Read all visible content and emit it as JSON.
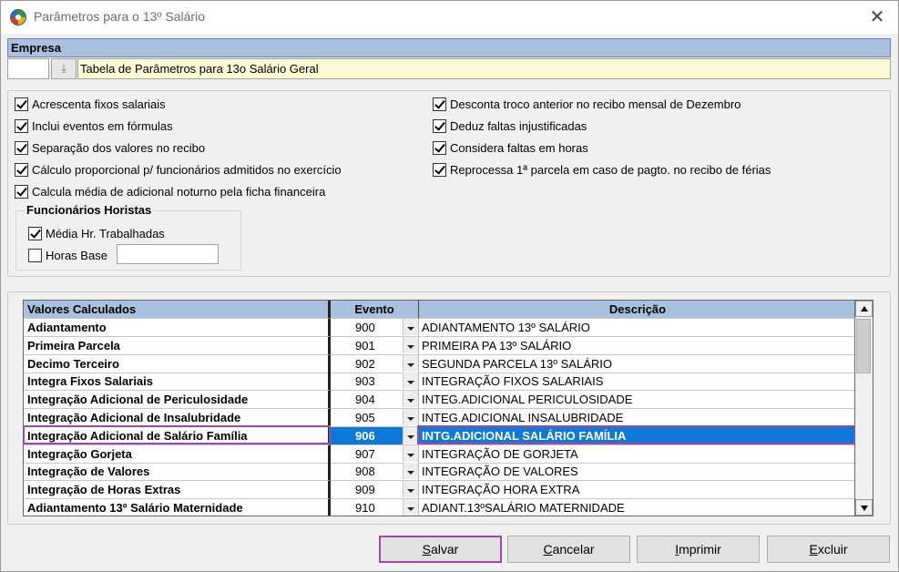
{
  "window": {
    "title": "Parâmetros para o 13º Salário",
    "close_glyph": "✕"
  },
  "empresa": {
    "header": "Empresa",
    "code": "",
    "lookup_glyph": "⤓",
    "description": "Tabela de Parâmetros para 13o Salário Geral"
  },
  "options_left": [
    {
      "label": "Acrescenta fixos salariais",
      "checked": true
    },
    {
      "label": "Inclui eventos em fórmulas",
      "checked": true
    },
    {
      "label": "Separação dos valores no recibo",
      "checked": true
    },
    {
      "label": "Cálculo proporcional p/ funcionários admitidos no exercício",
      "checked": true
    },
    {
      "label": "Calcula média de adicional noturno pela ficha financeira",
      "checked": true
    }
  ],
  "options_right": [
    {
      "label": "Desconta troco anterior no recibo mensal de Dezembro",
      "checked": true
    },
    {
      "label": "Deduz faltas injustificadas",
      "checked": true
    },
    {
      "label": "Considera faltas em horas",
      "checked": true
    },
    {
      "label": "Reprocessa 1ª parcela em caso de pagto. no recibo de férias",
      "checked": true
    }
  ],
  "horistas": {
    "title": "Funcionários Horistas",
    "media": {
      "label": "Média Hr. Trabalhadas",
      "checked": true
    },
    "horas_base": {
      "label": "Horas Base",
      "checked": false,
      "value": ""
    }
  },
  "grid": {
    "headers": {
      "valores": "Valores Calculados",
      "evento": "Evento",
      "descricao": "Descrição"
    },
    "rows": [
      {
        "name": "Adiantamento",
        "event": "900",
        "desc": "ADIANTAMENTO 13º SALÁRIO"
      },
      {
        "name": "Primeira Parcela",
        "event": "901",
        "desc": "PRIMEIRA PA 13º SALÁRIO"
      },
      {
        "name": "Decimo Terceiro",
        "event": "902",
        "desc": "SEGUNDA PARCELA 13º SALÁRIO"
      },
      {
        "name": "Integra Fixos Salariais",
        "event": "903",
        "desc": "INTEGRAÇÃO FIXOS SALARIAIS"
      },
      {
        "name": "Integração Adicional de Periculosidade",
        "event": "904",
        "desc": "INTEG.ADICIONAL PERICULOSIDADE"
      },
      {
        "name": "Integração Adicional de Insalubridade",
        "event": "905",
        "desc": "INTEG.ADICIONAL INSALUBRIDADE"
      },
      {
        "name": "Integração Adicional de Salário Família",
        "event": "906",
        "desc": "INTG.ADICIONAL SALÁRIO FAMÍLIA"
      },
      {
        "name": "Integração Gorjeta",
        "event": "907",
        "desc": "INTEGRAÇÃO DE GORJETA"
      },
      {
        "name": "Integração de Valores",
        "event": "908",
        "desc": "INTEGRAÇÃO DE VALORES"
      },
      {
        "name": "Integração de Horas Extras",
        "event": "909",
        "desc": "INTEGRAÇÃO HORA EXTRA"
      },
      {
        "name": "Adiantamento 13º Salário Maternidade",
        "event": "910",
        "desc": "ADIANT.13ºSALÁRIO MATERNIDADE"
      }
    ],
    "selected_index": 6,
    "highlight_color": "#0f79d7",
    "outline_color": "#9b4ba6"
  },
  "buttons": {
    "salvar": {
      "mnemonic": "S",
      "rest": "alvar"
    },
    "cancelar": {
      "mnemonic": "C",
      "rest": "ancelar"
    },
    "imprimir": {
      "mnemonic": "I",
      "rest": "mprimir"
    },
    "excluir": {
      "mnemonic": "E",
      "rest": "xcluir"
    }
  }
}
